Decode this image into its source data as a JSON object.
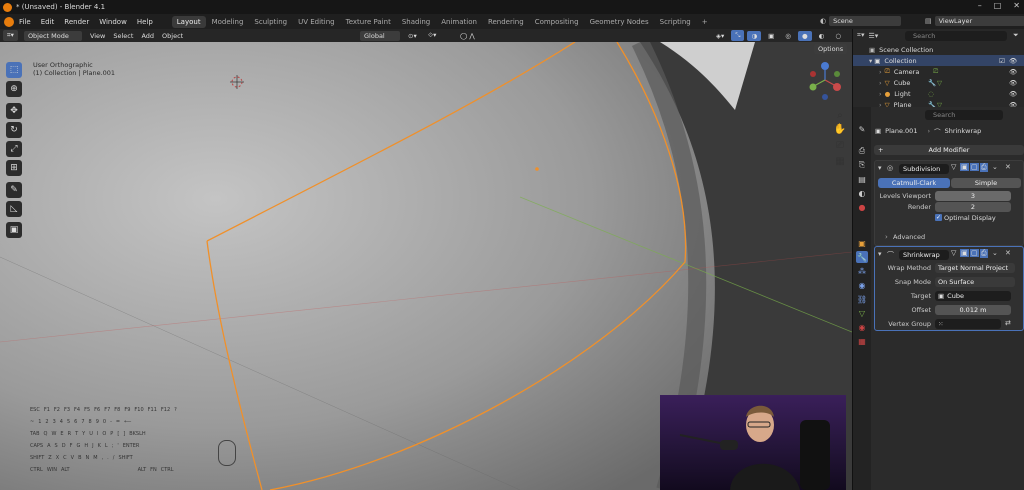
{
  "title": "* (Unsaved) - Blender 4.1",
  "menus": [
    "File",
    "Edit",
    "Render",
    "Window",
    "Help"
  ],
  "workspaces": [
    "Layout",
    "Modeling",
    "Sculpting",
    "UV Editing",
    "Texture Paint",
    "Shading",
    "Animation",
    "Rendering",
    "Compositing",
    "Geometry Nodes",
    "Scripting"
  ],
  "active_workspace": "Layout",
  "scene": "Scene",
  "view_layer": "ViewLayer",
  "viewport_header": {
    "mode": "Object Mode",
    "view": "View",
    "select": "Select",
    "add": "Add",
    "object": "Object",
    "orientation": "Global",
    "options": "Options"
  },
  "viewport_info": {
    "line1": "User Orthographic",
    "line2": "(1) Collection | Plane.001"
  },
  "keyboard_rows": [
    [
      "ESC",
      "F1",
      "F2",
      "F3",
      "F4",
      "F5",
      "F6",
      "F7",
      "F8",
      "F9",
      "F10",
      "F11",
      "F12",
      "?"
    ],
    [
      "~",
      "1",
      "2",
      "3",
      "4",
      "5",
      "6",
      "7",
      "8",
      "9",
      "0",
      "-",
      "=",
      "⟵"
    ],
    [
      "TAB",
      "Q",
      "W",
      "E",
      "R",
      "T",
      "Y",
      "U",
      "I",
      "O",
      "P",
      "[",
      "]",
      "BKSLH"
    ],
    [
      "CAPS",
      "A",
      "S",
      "D",
      "F",
      "G",
      "H",
      "J",
      "K",
      "L",
      ";",
      "'",
      "ENTER"
    ],
    [
      "SHIFT",
      "Z",
      "X",
      "C",
      "V",
      "B",
      "N",
      "M",
      ",",
      ".",
      "/",
      "SHIFT"
    ],
    [
      "CTRL",
      "WIN",
      "ALT",
      "",
      "",
      "",
      "",
      "",
      "",
      "",
      "ALT",
      "FN",
      "CTRL"
    ]
  ],
  "outliner": {
    "search_placeholder": "Search",
    "root": "Scene Collection",
    "collection": "Collection",
    "items": [
      "Camera",
      "Cube",
      "Light",
      "Plane"
    ]
  },
  "properties": {
    "search_placeholder": "Search",
    "breadcrumb_object": "Plane.001",
    "breadcrumb_modifier": "Shrinkwrap",
    "add_modifier": "Add Modifier",
    "subdivision": {
      "name": "Subdivision",
      "tab_catmull": "Catmull-Clark",
      "tab_simple": "Simple",
      "levels_viewport_label": "Levels Viewport",
      "levels_viewport": "3",
      "render_label": "Render",
      "render": "2",
      "optimal_display": "Optimal Display",
      "advanced": "Advanced"
    },
    "shrinkwrap": {
      "name": "Shrinkwrap",
      "wrap_method_label": "Wrap Method",
      "wrap_method": "Target Normal Project",
      "snap_mode_label": "Snap Mode",
      "snap_mode": "On Surface",
      "target_label": "Target",
      "target": "Cube",
      "offset_label": "Offset",
      "offset": "0.012 m",
      "vertex_group_label": "Vertex Group"
    }
  },
  "colors": {
    "selection_outline": "#f0902a",
    "accent_blue": "#4a72b8",
    "axis_x": "#c84a4a",
    "axis_y": "#7ab04a",
    "axis_z": "#4a7ad0"
  },
  "icons": [
    "blender-logo-icon",
    "select-box-icon",
    "cursor-icon",
    "move-icon",
    "rotate-icon",
    "scale-icon",
    "transform-icon",
    "annotate-icon",
    "measure-icon",
    "add-cube-icon",
    "zoom-icon",
    "hand-icon",
    "camera-view-icon",
    "grid-icon",
    "wrench-icon"
  ]
}
